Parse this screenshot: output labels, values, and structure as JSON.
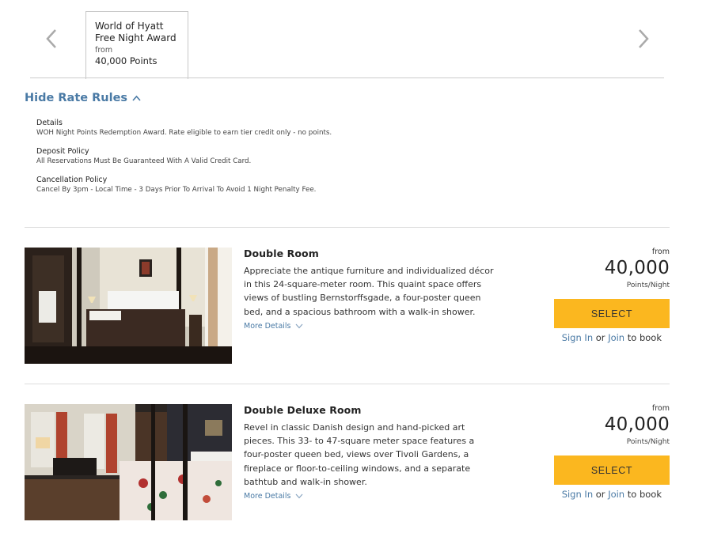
{
  "rate_tabs": {
    "active_tab": {
      "line1": "World of Hyatt",
      "line2": "Free Night Award",
      "from_label": "from",
      "points": "40,000 Points"
    }
  },
  "rate_rules": {
    "toggle_label": "Hide Rate Rules",
    "rules": [
      {
        "heading": "Details",
        "text": "WOH Night Points Redemption Award. Rate eligible to earn tier credit only - no points."
      },
      {
        "heading": "Deposit Policy",
        "text": "All Reservations Must Be Guaranteed With A Valid Credit Card."
      },
      {
        "heading": "Cancellation Policy",
        "text": "Cancel By 3pm - Local Time - 3 Days Prior To Arrival To Avoid 1 Night Penalty Fee."
      }
    ]
  },
  "rooms": [
    {
      "title": "Double Room",
      "description": "Appreciate the antique furniture and individualized décor in this 24-square-meter room. This quaint space offers views of bustling Bernstorffsgade, a four-poster queen bed, and a spacious bathroom with a walk-in shower.",
      "more_details": "More Details",
      "from_label": "from",
      "price": "40,000",
      "unit": "Points/Night",
      "select_label": "SELECT",
      "sign_in": "Sign In",
      "or_text": "or",
      "join": "Join",
      "to_book": "to book"
    },
    {
      "title": "Double Deluxe Room",
      "description": "Revel in classic Danish design and hand-picked art pieces. This 33- to 47-square meter space features a four-poster queen bed, views over Tivoli Gardens, a fireplace or floor-to-ceiling windows, and a separate bathtub and walk-in shower.",
      "more_details": "More Details",
      "from_label": "from",
      "price": "40,000",
      "unit": "Points/Night",
      "select_label": "SELECT",
      "sign_in": "Sign In",
      "or_text": "or",
      "join": "Join",
      "to_book": "to book"
    }
  ],
  "colors": {
    "accent_link": "#4a7aa5",
    "select_button": "#fbb71f"
  }
}
